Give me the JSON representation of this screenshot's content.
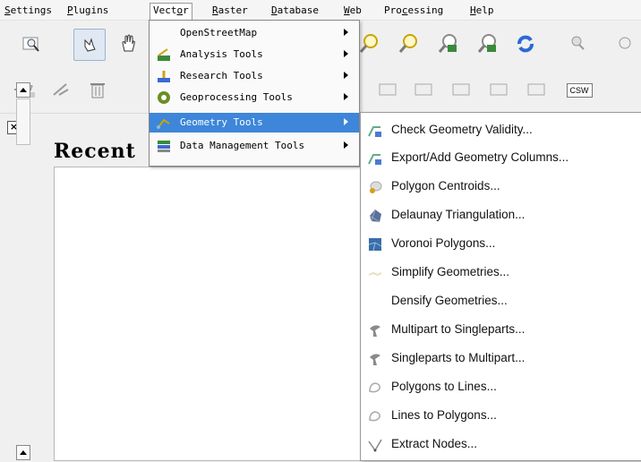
{
  "menubar": [
    {
      "pre": "",
      "u": "S",
      "post": "ettings"
    },
    {
      "pre": "",
      "u": "P",
      "post": "lugins"
    },
    {
      "pre": "Vect",
      "u": "o",
      "post": "r"
    },
    {
      "pre": "",
      "u": "R",
      "post": "aster"
    },
    {
      "pre": "",
      "u": "D",
      "post": "atabase"
    },
    {
      "pre": "",
      "u": "W",
      "post": "eb"
    },
    {
      "pre": "Pro",
      "u": "c",
      "post": "essing"
    },
    {
      "pre": "",
      "u": "H",
      "post": "elp"
    }
  ],
  "vector_menu": [
    {
      "label": "OpenStreetMap",
      "icon": "none"
    },
    {
      "label": "Analysis Tools",
      "icon": "analysis-icon"
    },
    {
      "label": "Research Tools",
      "icon": "research-icon"
    },
    {
      "label": "Geoprocessing Tools",
      "icon": "geoprocessing-icon"
    },
    {
      "label": "Geometry Tools",
      "icon": "geometry-icon"
    },
    {
      "label": "Data Management Tools",
      "icon": "data-management-icon"
    }
  ],
  "geometry_menu": [
    {
      "label": "Check Geometry Validity...",
      "icon": "check-geometry-icon"
    },
    {
      "label": "Export/Add Geometry Columns...",
      "icon": "export-geometry-icon"
    },
    {
      "label": "Polygon Centroids...",
      "icon": "centroid-icon"
    },
    {
      "label": "Delaunay Triangulation...",
      "icon": "delaunay-icon"
    },
    {
      "label": "Voronoi Polygons...",
      "icon": "voronoi-icon"
    },
    {
      "label": "Simplify Geometries...",
      "icon": "simplify-icon"
    },
    {
      "label": "Densify Geometries...",
      "icon": "none"
    },
    {
      "label": "Multipart to Singleparts...",
      "icon": "multipart-icon"
    },
    {
      "label": "Singleparts to Multipart...",
      "icon": "singlepart-icon"
    },
    {
      "label": "Polygons to Lines...",
      "icon": "polygon-to-line-icon"
    },
    {
      "label": "Lines to Polygons...",
      "icon": "line-to-polygon-icon"
    },
    {
      "label": "Extract Nodes...",
      "icon": "extract-nodes-icon"
    }
  ],
  "panel": {
    "title": "Recent",
    "close_label": "×"
  },
  "toolbar": {
    "csw_label": "CSW"
  },
  "colors": {
    "highlight": "#3d86d9",
    "menu_bg": "#fafafa"
  }
}
